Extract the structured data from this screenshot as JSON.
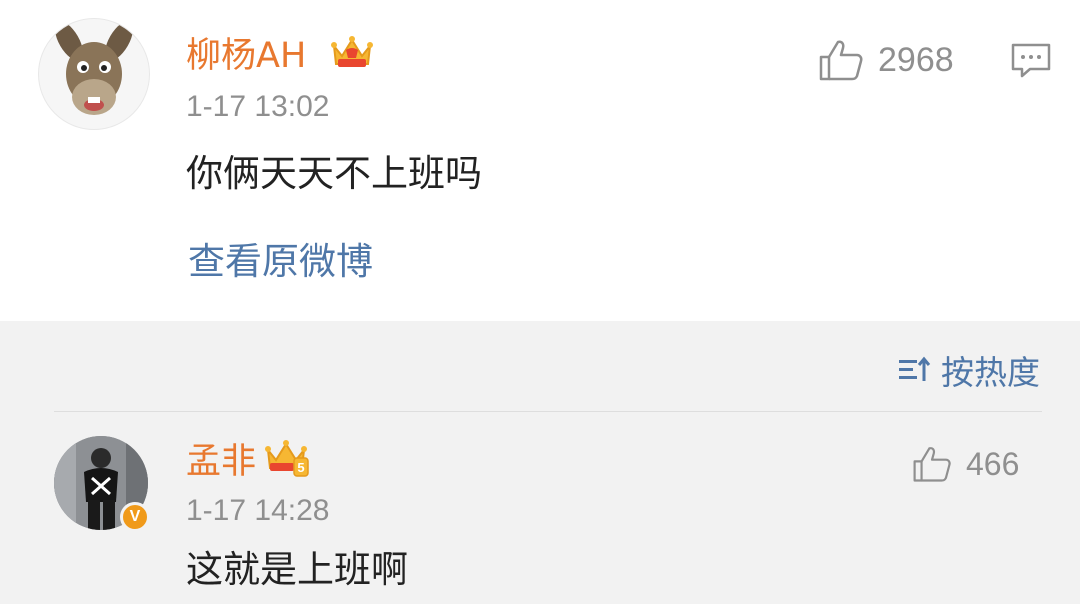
{
  "post": {
    "username": "柳杨AH",
    "timestamp": "1-17 13:02",
    "content": "你俩天天不上班吗",
    "like_count": "2968",
    "view_original": "查看原微博"
  },
  "sort": {
    "label": "按热度"
  },
  "reply": {
    "username": "孟非",
    "timestamp": "1-17 14:28",
    "content": "这就是上班啊",
    "like_count": "466",
    "verified_badge": "V",
    "crown_level": "5"
  },
  "colors": {
    "username": "#e8782f",
    "link": "#4f77a8",
    "muted": "#8f8f8f",
    "section_bg": "#f2f2f2"
  }
}
